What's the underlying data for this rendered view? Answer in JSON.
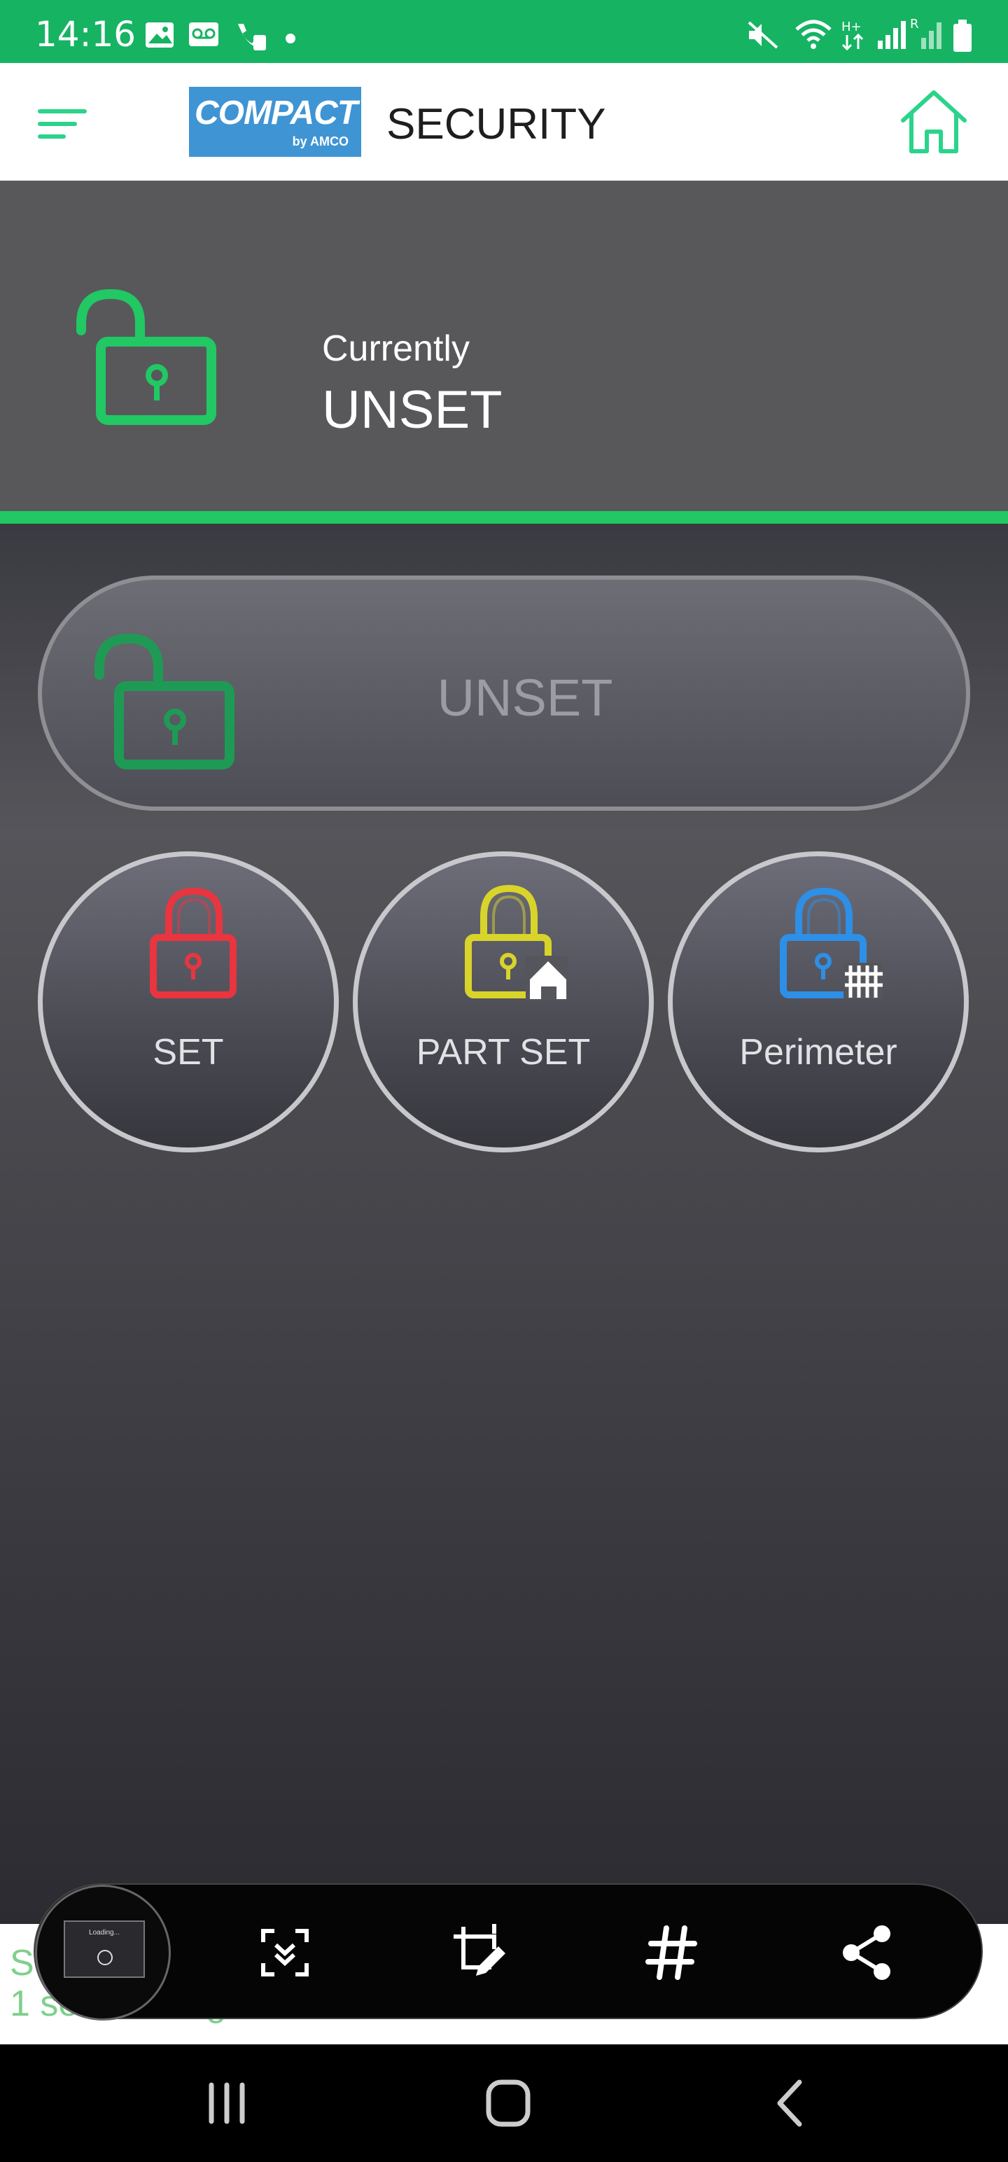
{
  "status_bar": {
    "time": "14:16"
  },
  "app_bar": {
    "logo_main": "COMPACT",
    "logo_sub": "by AMCO",
    "title": "SECURITY"
  },
  "status": {
    "label": "Currently",
    "value": "UNSET"
  },
  "actions": {
    "unset": "UNSET",
    "set": "SET",
    "part_set": "PART SET",
    "perimeter": "Perimeter"
  },
  "update_text": {
    "line1": "S",
    "line2": "1 seconds ago"
  },
  "toolbar": {
    "thumbnail_text": "Loading..."
  },
  "colors": {
    "status_bar": "#16b363",
    "accent_green": "#21c863",
    "set_red": "#e8353f",
    "part_set_yellow": "#d9d42a",
    "perimeter_blue": "#2d8fe6"
  },
  "icons": {
    "menu": "menu-icon",
    "home": "home-icon",
    "status_lock": "unlocked-padlock-icon",
    "set": "locked-padlock-icon",
    "part_set": "padlock-house-icon",
    "perimeter": "padlock-fence-icon"
  }
}
